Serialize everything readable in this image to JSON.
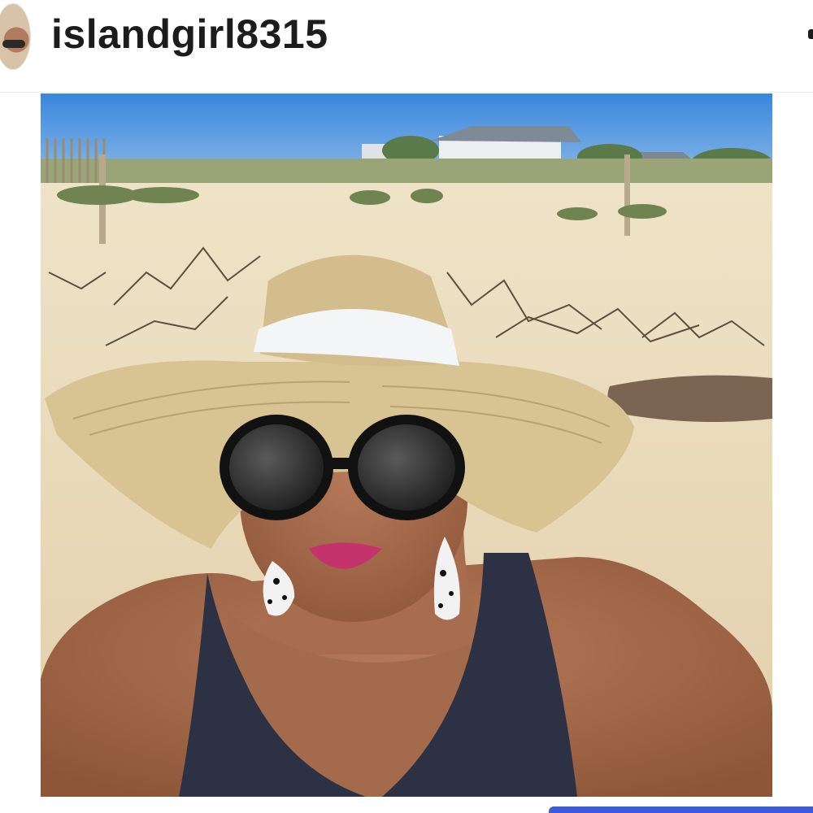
{
  "post": {
    "username": "islandgirl8315",
    "avatar_icon": "profile-avatar",
    "more_icon": "more-options-icon",
    "photo_icon": "beach-selfie-photo"
  },
  "colors": {
    "sky": "#3f8be0",
    "sand": "#e8d7b6",
    "hat": "#d8c393",
    "tank_top": "#2c3244",
    "accent_bar": "#3b5bdb"
  }
}
